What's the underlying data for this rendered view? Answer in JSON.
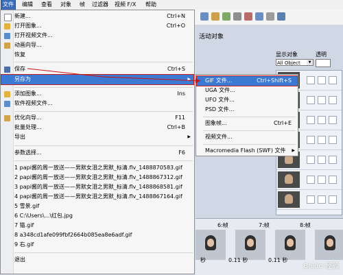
{
  "menubar": {
    "items": [
      "文件",
      "编辑",
      "查看",
      "对象",
      "帧",
      "过滤器",
      "视频 F/X",
      "帮助"
    ]
  },
  "panel": {
    "title": "活动对象",
    "display_label": "显示对象",
    "opacity_label": "透明",
    "object_select": "All Object"
  },
  "file_menu": {
    "items": [
      {
        "label": "新建...",
        "shortcut": "Ctrl+N"
      },
      {
        "label": "打开图象...",
        "shortcut": "Ctrl+O"
      },
      {
        "label": "打开视频文件...",
        "shortcut": ""
      },
      {
        "label": "动画向导...",
        "shortcut": ""
      },
      {
        "label": "恢复",
        "shortcut": ""
      },
      {
        "label": "保存",
        "shortcut": "Ctrl+S"
      },
      {
        "label": "另存为",
        "shortcut": "",
        "submenu": true
      },
      {
        "label": "添加图象...",
        "shortcut": "Ins"
      },
      {
        "label": "软件视频文件...",
        "shortcut": ""
      },
      {
        "label": "优化向导...",
        "shortcut": "F11"
      },
      {
        "label": "批量处理...",
        "shortcut": "Ctrl+B"
      },
      {
        "label": "导出",
        "shortcut": "",
        "submenu": true
      },
      {
        "label": "参数选择...",
        "shortcut": "F6"
      },
      {
        "label": "1 papi酱的周一放送——男默女泪之男默_标清.flv_1488870583.gif"
      },
      {
        "label": "2 papi酱的周一放送——男默女泪之男默_标清.flv_1488867312.gif"
      },
      {
        "label": "3 papi酱的周一放送——男默女泪之男默_标清.flv_1488868581.gif"
      },
      {
        "label": "4 papi酱的周一放送——男默女泪之男默_标清.flv_1488867164.gif"
      },
      {
        "label": "5 雪景.gif"
      },
      {
        "label": "6 C:\\Users\\...\\红包.jpg"
      },
      {
        "label": "7 猫.gif"
      },
      {
        "label": "8 a348cd1afe099fbf2664b085ea8e6adf.gif"
      },
      {
        "label": "9 右.gif"
      },
      {
        "label": "退出"
      }
    ]
  },
  "saveas_submenu": {
    "items": [
      {
        "label": "GIF 文件...",
        "shortcut": "Ctrl+Shift+S"
      },
      {
        "label": "UGA 文件...",
        "shortcut": ""
      },
      {
        "label": "UFO 文件...",
        "shortcut": ""
      },
      {
        "label": "PSD 文件...",
        "shortcut": ""
      },
      {
        "label": "图象帧...",
        "shortcut": "Ctrl+E"
      },
      {
        "label": "视频文件...",
        "shortcut": ""
      },
      {
        "label": "Macromedia Flash (SWF) 文件",
        "shortcut": "",
        "submenu": true
      }
    ]
  },
  "frames": {
    "labels": [
      "6:帧",
      "7:帧",
      "8:帧"
    ],
    "times": [
      "秒",
      "0.11 秒",
      "0.11 秒"
    ]
  },
  "watermark": "Baidu 经验",
  "colors": {
    "highlight": "#3b79d2",
    "annotation_red": "#d01010"
  }
}
